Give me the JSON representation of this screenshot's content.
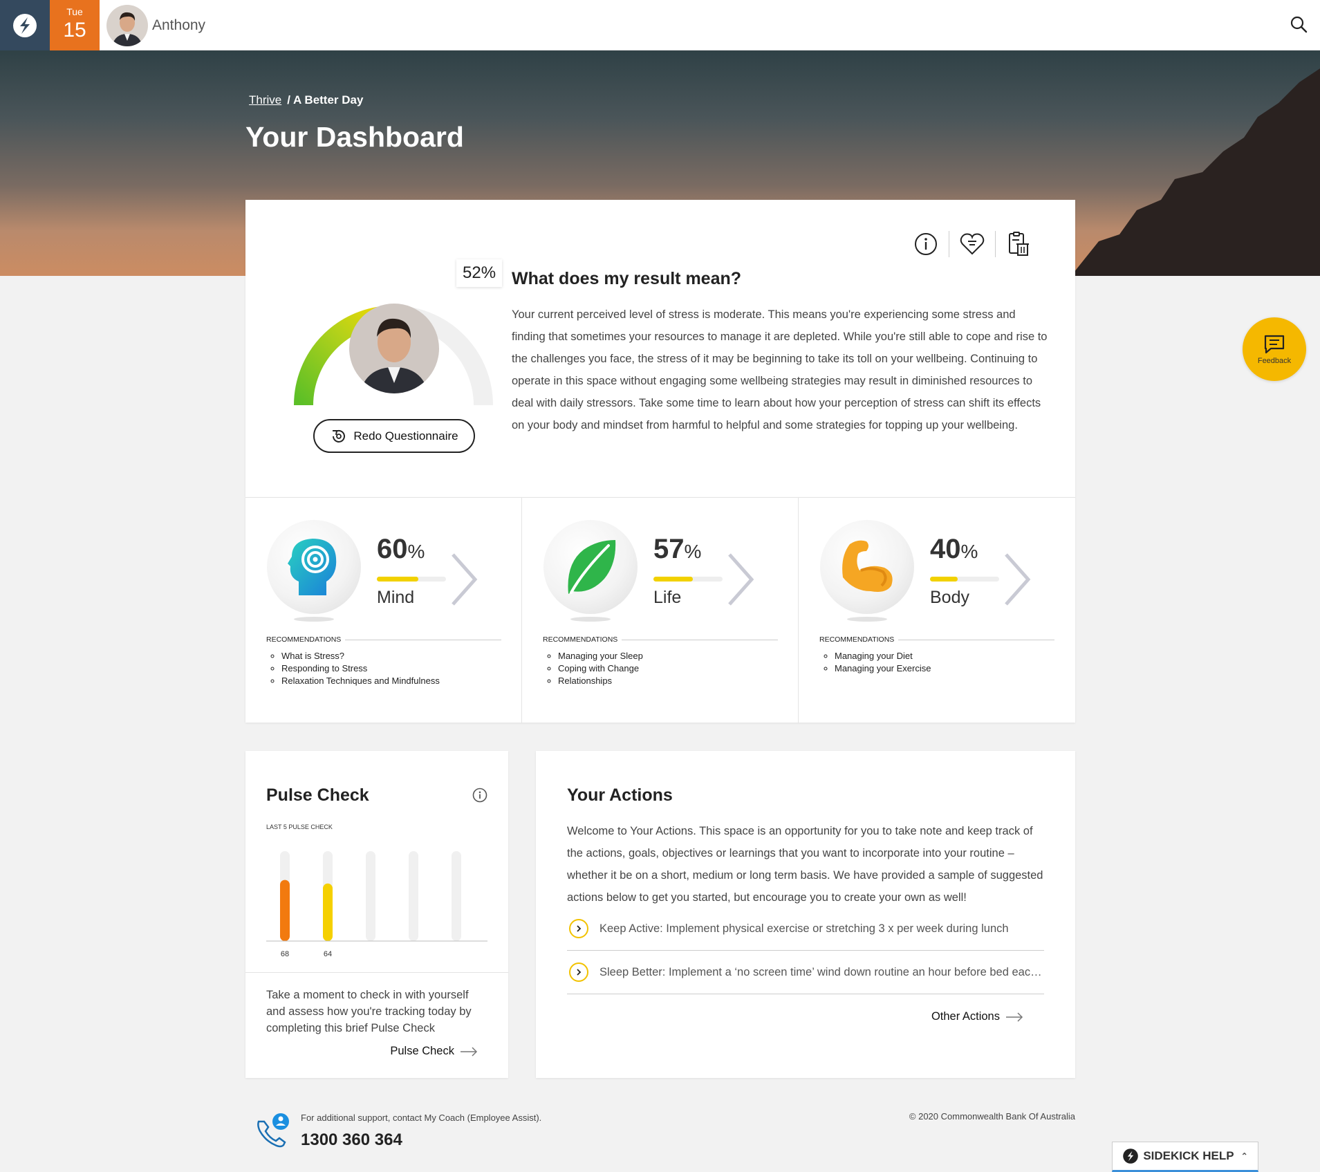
{
  "topbar": {
    "day_of_week": "Tue",
    "day": "15",
    "user_name": "Anthony"
  },
  "hero": {
    "breadcrumb_root": "Thrive",
    "breadcrumb_current": "/ A Better Day",
    "title": "Your Dashboard"
  },
  "result": {
    "percent": 52,
    "percent_label": "52%",
    "title": "What does my result mean?",
    "text": "Your current perceived level of stress is moderate. This means you're experiencing some stress and finding that sometimes your resources to manage it are depleted. While you're still able to cope and rise to the challenges you face, the stress of it may be beginning to take its toll on your wellbeing. Continuing to operate in this space without engaging some wellbeing strategies may result in diminished resources to deal with daily stressors. Take some time to learn about how your perception of stress can shift its effects on your body and mindset from harmful to helpful and some strategies for topping up your wellbeing.",
    "redo_label": "Redo Questionnaire",
    "icons": [
      "info-icon",
      "heart-list-icon",
      "clipboard-delete-icon"
    ]
  },
  "categories": [
    {
      "pct": "60",
      "pct_value": 60,
      "unit": "%",
      "name": "Mind",
      "icon": "head-target-icon",
      "rec_heading": "RECOMMENDATIONS",
      "recs": [
        "What is Stress?",
        "Responding to Stress",
        "Relaxation Techniques and Mindfulness"
      ]
    },
    {
      "pct": "57",
      "pct_value": 57,
      "unit": "%",
      "name": "Life",
      "icon": "leaf-icon",
      "rec_heading": "RECOMMENDATIONS",
      "recs": [
        "Managing your Sleep",
        "Coping with Change",
        "Relationships"
      ]
    },
    {
      "pct": "40",
      "pct_value": 40,
      "unit": "%",
      "name": "Body",
      "icon": "flexed-arm-icon",
      "rec_heading": "RECOMMENDATIONS",
      "recs": [
        "Managing your Diet",
        "Managing your Exercise"
      ]
    }
  ],
  "pulse": {
    "title": "Pulse Check",
    "subtitle": "LAST 5 PULSE CHECK",
    "text": "Take a moment to check in with yourself and assess how you're tracking today by completing this brief Pulse Check",
    "link": "Pulse Check"
  },
  "chart_data": {
    "type": "bar",
    "title": "LAST 5 PULSE CHECK",
    "categories": [
      "",
      "",
      "",
      "",
      ""
    ],
    "values": [
      68,
      64,
      null,
      null,
      null
    ],
    "labels": [
      "68",
      "64",
      "",
      "",
      ""
    ],
    "colors": [
      "#f27a0f",
      "#f5d000"
    ],
    "ylim": [
      0,
      100
    ],
    "grid": false
  },
  "actions": {
    "title": "Your Actions",
    "text": "Welcome to Your Actions. This space is an opportunity for you to take note and keep track of the actions, goals, objectives or learnings that you want to incorporate into your routine – whether it be on a short, medium or long term basis. We have provided a sample of suggested actions below to get you started, but encourage you to create your own as well!",
    "items": [
      "Keep Active: Implement physical exercise or stretching 3 x per week during lunch",
      "Sleep Better: Implement a ‘no screen time’ wind down routine an hour before bed each night"
    ],
    "other_link": "Other Actions"
  },
  "footer": {
    "support_text": "For additional support, contact My Coach (Employee Assist).",
    "phone": "1300 360 364",
    "copyright": "© 2020 Commonwealth Bank Of Australia"
  },
  "feedback_label": "Feedback",
  "sidekick_label": "SIDEKICK HELP",
  "colors": {
    "accent_orange": "#e8721e",
    "feedback_yellow": "#f5b800",
    "bar_yellow": "#f2d100"
  }
}
